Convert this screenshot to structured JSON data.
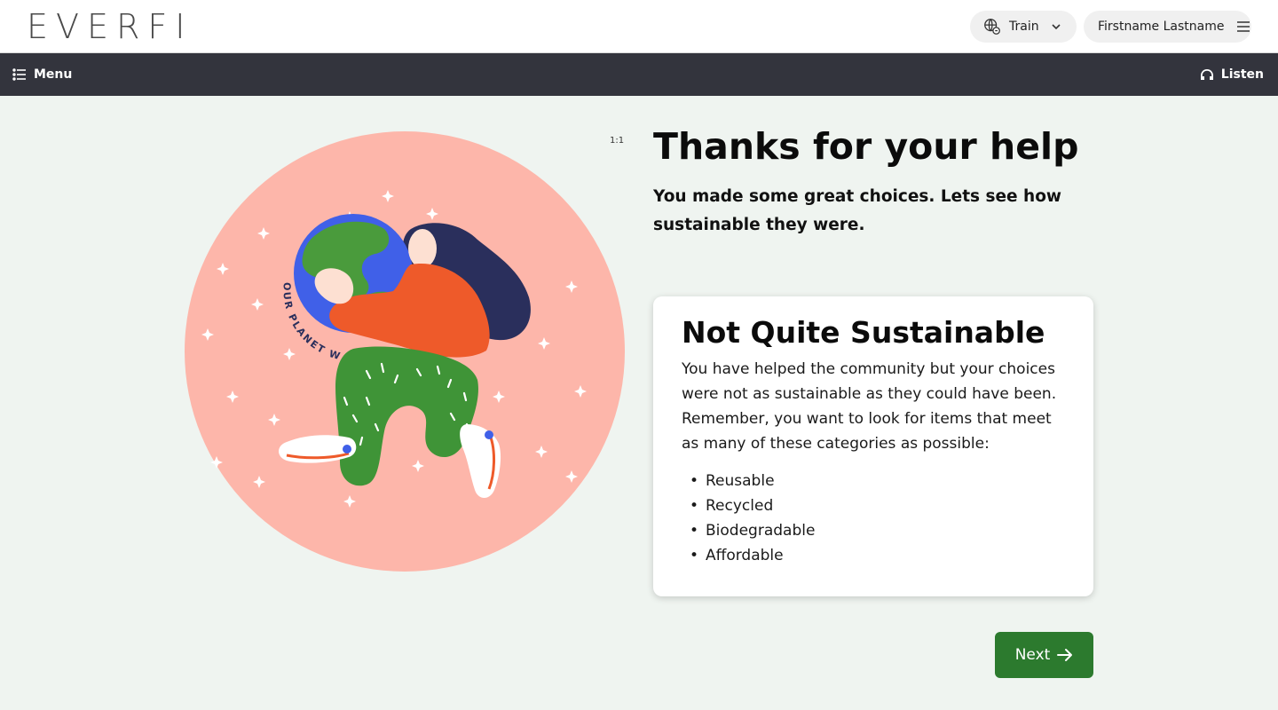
{
  "header": {
    "logo_text": "EVERFI",
    "train_label": "Train",
    "user_label": "Firstname Lastname"
  },
  "nav": {
    "menu_label": "Menu",
    "listen_label": "Listen"
  },
  "content": {
    "ratio_label": "1:1",
    "title": "Thanks for your help",
    "subtitle": "You made some great choices. Lets see how sustainable they were.",
    "illustration_text": "OUR PLANET WEEK",
    "card": {
      "title": "Not Quite Sustainable",
      "body": "You have helped the community but your choices were not as sustainable as they could have been. Remember, you want to look for items that meet as many of these categories as possible:",
      "items": [
        "Reusable",
        "Recycled",
        "Biodegradable",
        "Affordable"
      ]
    },
    "next_label": "Next"
  },
  "colors": {
    "accent": "#e4572e",
    "nav_bg": "#33343d",
    "page_bg": "#eff4f0",
    "circle": "#fdb6aa",
    "next_bg": "#2c7a2e"
  },
  "icons": {
    "globe": "globe-icon",
    "chevron": "chevron-down-icon",
    "hamburger": "hamburger-icon",
    "list": "list-icon",
    "headphones": "headphones-icon",
    "arrow": "arrow-right-icon"
  }
}
